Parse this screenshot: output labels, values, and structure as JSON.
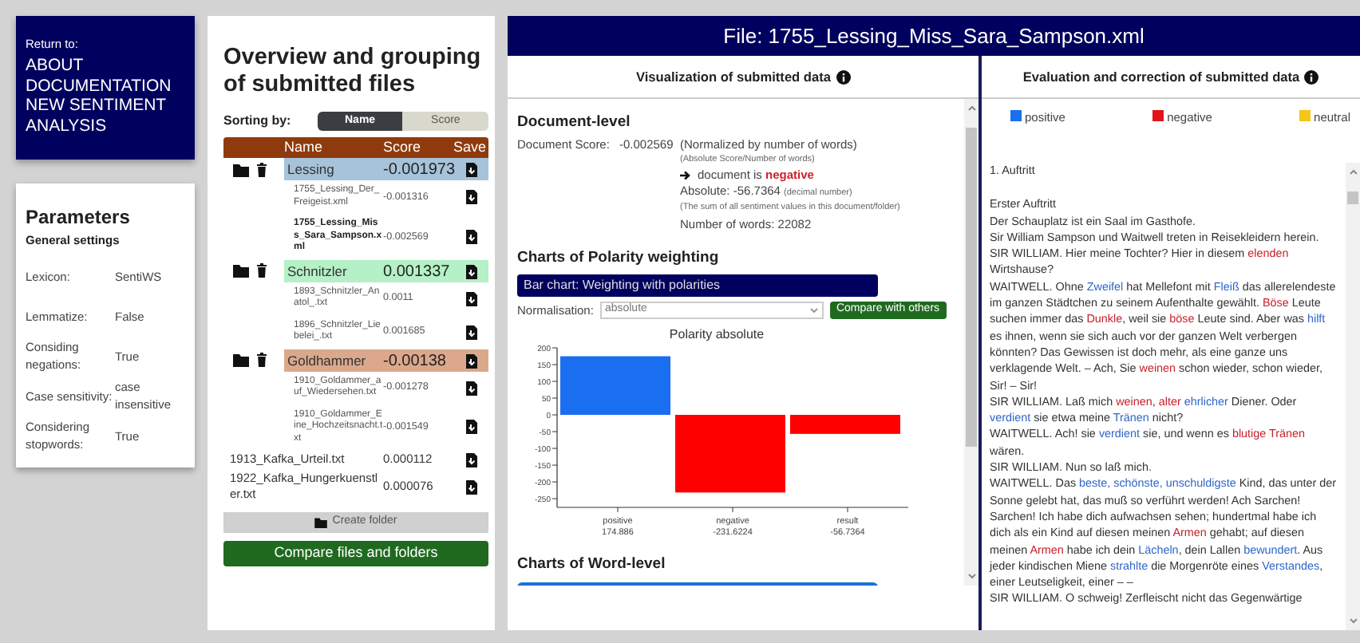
{
  "nav": {
    "caption": "Return to:",
    "links": [
      "ABOUT",
      "DOCUMENTATION",
      "NEW SENTIMENT ANALYSIS"
    ]
  },
  "parameters": {
    "title": "Parameters",
    "section": "General settings",
    "rows": [
      {
        "label": "Lexicon:",
        "value": "SentiWS"
      },
      {
        "label": "Lemmatize:",
        "value": "False"
      },
      {
        "label": "Considing negations:",
        "value": "True"
      },
      {
        "label": "Case sensitivity:",
        "value": "case insensitive"
      },
      {
        "label": "Considering stopwords:",
        "value": "True"
      }
    ]
  },
  "files": {
    "title": "Overview and grouping of submitted files",
    "sort_label": "Sorting by:",
    "sort_options": [
      {
        "label": "Name",
        "selected": true
      },
      {
        "label": "Score",
        "selected": false
      }
    ],
    "columns": [
      "Name",
      "Score",
      "Save"
    ],
    "items": [
      {
        "kind": "folder",
        "name": "Lessing",
        "score": "-0.001973",
        "color": "#a6c3da",
        "children": [
          {
            "name": "1755_Lessing_Der_Freigeist.xml",
            "score": "-0.001316",
            "selected": false
          },
          {
            "name": "1755_Lessing_Miss_Sara_Sampson.xml",
            "score": "-0.002569",
            "selected": true
          }
        ]
      },
      {
        "kind": "folder",
        "name": "Schnitzler",
        "score": "0.001337",
        "color": "#b5f0c6",
        "children": [
          {
            "name": "1893_Schnitzler_Anatol_.txt",
            "score": "0.0011",
            "selected": false
          },
          {
            "name": "1896_Schnitzler_Liebelei_.txt",
            "score": "0.001685",
            "selected": false
          }
        ]
      },
      {
        "kind": "folder",
        "name": "Goldhammer",
        "score": "-0.00138",
        "color": "#dba88c",
        "children": [
          {
            "name": "1910_Goldammer_auf_Wiedersehen.txt",
            "score": "-0.001278",
            "selected": false
          },
          {
            "name": "1910_Goldammer_Eine_Hochzeitsnacht.txt",
            "score": "-0.001549",
            "selected": false
          }
        ]
      },
      {
        "kind": "file",
        "name": "1913_Kafka_Urteil.txt",
        "score": "0.000112",
        "selected": false
      },
      {
        "kind": "file",
        "name": "1922_Kafka_Hungerkuenstler.txt",
        "score": "0.000076",
        "selected": false
      }
    ],
    "create_button": "Create folder",
    "compare_button": "Compare files and folders"
  },
  "main": {
    "title": "File: 1755_Lessing_Miss_Sara_Sampson.xml",
    "visualization": {
      "heading": "Visualization of submitted data",
      "document_level": {
        "heading": "Document-level",
        "score_label": "Document Score:",
        "score": "-0.002569",
        "note": "(Normalized by number of words)",
        "subnote": "(Absolute Score/Number of words)",
        "verdict_text": "document is",
        "verdict": "negative",
        "absolute": "Absolute: -56.7364",
        "absolute_note": "(decimal number)",
        "sum_note": "(The sum of all sentiment values in this document/folder)",
        "words": "Number of words: 22082"
      },
      "polarity": {
        "heading": "Charts of Polarity weighting",
        "accordion": "Bar chart: Weighting with polarities",
        "normalisation_label": "Normalisation:",
        "normalisation_value": "absolute",
        "compare_button": "Compare with others",
        "chart_data": {
          "type": "bar",
          "title": "Polarity absolute",
          "categories": [
            "positive",
            "negative",
            "result"
          ],
          "values": [
            174.886,
            -231.6224,
            -56.7364
          ],
          "ylim": [
            -276,
            200
          ],
          "yticks": [
            200,
            150,
            100,
            50,
            0,
            -50,
            -100,
            -150,
            -200,
            -250
          ],
          "value_labels": [
            "174.886",
            "-231.6224",
            "-56.7364"
          ]
        }
      },
      "word_level": {
        "heading": "Charts of Word-level"
      }
    },
    "evaluation": {
      "heading": "Evaluation and correction of submitted data",
      "legend": [
        {
          "label": "positive",
          "color": "#1a6ef0"
        },
        {
          "label": "negative",
          "color": "#e0141e"
        },
        {
          "label": "neutral",
          "color": "#f5c518"
        }
      ],
      "paragraphs": [
        {
          "kind": "scene",
          "segments": [
            {
              "text": "1. Auftritt"
            }
          ]
        },
        {
          "kind": "line",
          "segments": [
            {
              "text": "Erster Auftritt"
            }
          ]
        },
        {
          "kind": "line",
          "segments": [
            {
              "text": "Der Schauplatz ist ein Saal im Gasthofe."
            }
          ]
        },
        {
          "kind": "line",
          "segments": [
            {
              "text": "Sir William Sampson und Waitwell treten in Reisekleidern herein."
            }
          ]
        },
        {
          "kind": "line",
          "segments": [
            {
              "text": "SIR WILLIAM. Hier meine Tochter? Hier in diesem "
            },
            {
              "text": "elenden",
              "color": "#c8202a"
            },
            {
              "text": " Wirtshause?"
            }
          ]
        },
        {
          "kind": "line",
          "segments": [
            {
              "text": "WAITWELL. Ohne "
            },
            {
              "text": "Zweifel",
              "color": "#2f66c8"
            },
            {
              "text": " hat Mellefont mit "
            },
            {
              "text": "Fleiß",
              "color": "#2f66c8"
            },
            {
              "text": " das allerelendeste im ganzen Städtchen zu seinem Aufenthalte gewählt. "
            },
            {
              "text": "Böse",
              "color": "#c8202a"
            },
            {
              "text": " Leute suchen immer das "
            },
            {
              "text": "Dunkle",
              "color": "#c8202a"
            },
            {
              "text": ", weil sie "
            },
            {
              "text": "böse",
              "color": "#c8202a"
            },
            {
              "text": " Leute sind. Aber was "
            },
            {
              "text": "hilft",
              "color": "#2f66c8"
            },
            {
              "text": " es ihnen, wenn sie sich auch vor der ganzen Welt verbergen könnten? Das Gewissen ist doch mehr, als eine ganze uns verklagende Welt. – Ach, Sie "
            },
            {
              "text": "weinen",
              "color": "#c8202a"
            },
            {
              "text": " schon wieder, schon wieder, Sir! – Sir!"
            }
          ]
        },
        {
          "kind": "line",
          "segments": [
            {
              "text": "SIR WILLIAM. Laß mich "
            },
            {
              "text": "weinen",
              "color": "#c8202a"
            },
            {
              "text": ", "
            },
            {
              "text": "alter",
              "color": "#c8202a"
            },
            {
              "text": " ehrlicher",
              "color": "#2f66c8"
            },
            {
              "text": " Diener. Oder "
            },
            {
              "text": "verdient",
              "color": "#2f66c8"
            },
            {
              "text": " sie etwa meine "
            },
            {
              "text": "Tränen",
              "color": "#2f66c8"
            },
            {
              "text": " nicht?"
            }
          ]
        },
        {
          "kind": "line",
          "segments": [
            {
              "text": "WAITWELL. Ach! sie "
            },
            {
              "text": "verdient",
              "color": "#2f66c8"
            },
            {
              "text": " sie, und wenn es "
            },
            {
              "text": "blutige Tränen",
              "color": "#c8202a"
            },
            {
              "text": " wären."
            }
          ]
        },
        {
          "kind": "line",
          "segments": [
            {
              "text": "SIR WILLIAM. Nun so laß mich."
            }
          ]
        },
        {
          "kind": "line",
          "segments": [
            {
              "text": "WAITWELL. Das "
            },
            {
              "text": "beste, schönste, unschuldigste",
              "color": "#2f66c8"
            },
            {
              "text": " Kind, das unter der Sonne gelebt hat, das muß so verführt werden! Ach Sarchen! Sarchen! Ich habe dich aufwachsen sehen; hundertmal habe ich dich als ein Kind auf diesen meinen "
            },
            {
              "text": "Armen",
              "color": "#c8202a"
            },
            {
              "text": " gehabt; auf diesen meinen "
            },
            {
              "text": "Armen",
              "color": "#c8202a"
            },
            {
              "text": " habe ich dein "
            },
            {
              "text": "Lächeln",
              "color": "#2f66c8"
            },
            {
              "text": ", dein Lallen "
            },
            {
              "text": "bewundert",
              "color": "#2f66c8"
            },
            {
              "text": ". Aus jeder kindischen Miene "
            },
            {
              "text": "strahlte",
              "color": "#2f66c8"
            },
            {
              "text": " die Morgenröte eines "
            },
            {
              "text": "Verstandes",
              "color": "#2f66c8"
            },
            {
              "text": ", einer Leutseligkeit, einer – –"
            }
          ]
        },
        {
          "kind": "line",
          "segments": [
            {
              "text": "SIR WILLIAM. O schweig! Zerfleischt nicht das Gegenwärtige"
            }
          ]
        }
      ]
    }
  }
}
